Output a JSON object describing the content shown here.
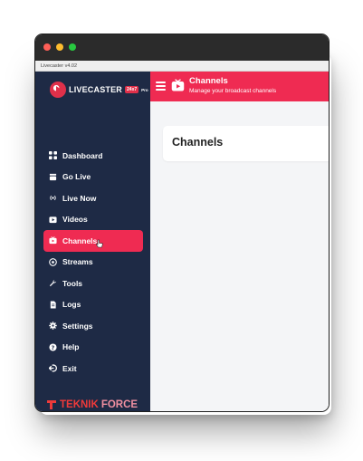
{
  "window": {
    "title": "Livecaster v4.02"
  },
  "logo": {
    "name": "LIVECASTER",
    "badge": "24x7",
    "tier": "Pro"
  },
  "sidebar": {
    "items": [
      {
        "label": "Dashboard",
        "icon": "dashboard-icon"
      },
      {
        "label": "Go Live",
        "icon": "broadcast-camera-icon"
      },
      {
        "label": "Live Now",
        "icon": "live-signal-icon"
      },
      {
        "label": "Videos",
        "icon": "video-icon"
      },
      {
        "label": "Channels",
        "icon": "tv-channel-icon",
        "active": true
      },
      {
        "label": "Streams",
        "icon": "streams-icon"
      },
      {
        "label": "Tools",
        "icon": "tools-icon"
      },
      {
        "label": "Logs",
        "icon": "logs-icon"
      },
      {
        "label": "Settings",
        "icon": "gear-icon"
      },
      {
        "label": "Help",
        "icon": "help-icon"
      },
      {
        "label": "Exit",
        "icon": "exit-icon"
      }
    ]
  },
  "brand": {
    "part1": "TEKNIK",
    "part2": "FORCE"
  },
  "header": {
    "title": "Channels",
    "subtitle": "Manage your broadcast channels"
  },
  "main": {
    "card_title": "Channels"
  },
  "colors": {
    "accent": "#ef2b52",
    "sidebar": "#1e2a45",
    "content_bg": "#f4f5f7"
  }
}
